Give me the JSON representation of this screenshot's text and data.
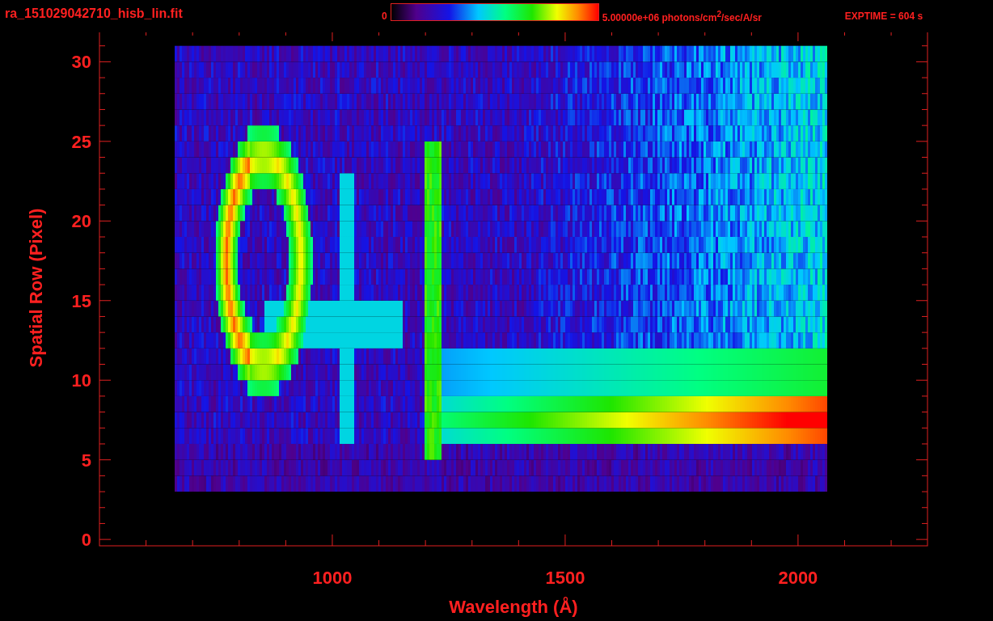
{
  "title": "ra_151029042710_hisb_lin.fit",
  "colorbar": {
    "min_label": "0",
    "max_label": "5.00000e+06 photons/cm$^{2}$/sec/A/sr"
  },
  "exposure": "EXPTIME = 604 s",
  "plot": {
    "xlabel": "Wavelength (Å)",
    "ylabel": "Spatial Row (Pixel)",
    "xticks": [
      "1000",
      "1500",
      "2000"
    ],
    "yticks": [
      "30",
      "25",
      "20",
      "15",
      "10",
      "5",
      "0"
    ]
  }
}
